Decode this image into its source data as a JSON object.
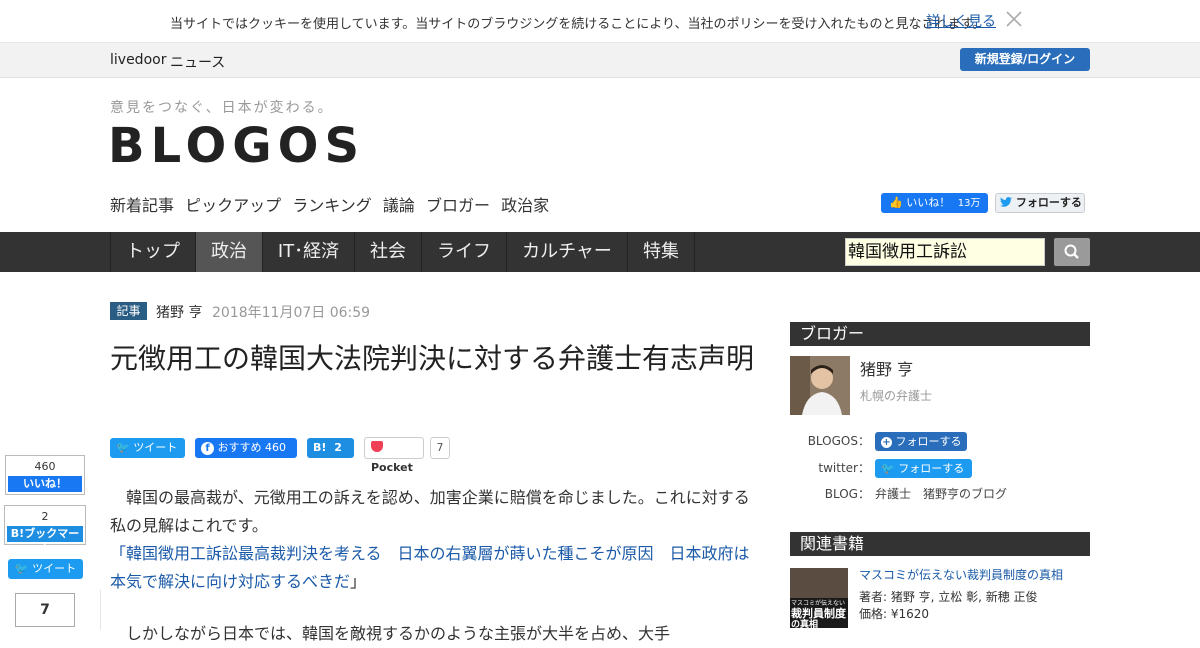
{
  "cookie": {
    "text": "当サイトではクッキーを使用しています。当サイトのブラウジングを続けることにより、当社のポリシーを受け入れたものと見なされます。",
    "link": "詳しく見る"
  },
  "livedoor": {
    "brand": "livedoor",
    "news": "ニュース",
    "login": "新規登録/ログイン"
  },
  "header": {
    "tagline": "意見をつなぐ、日本が変わる。",
    "logo": "BLOGOS",
    "subnav": [
      "新着記事",
      "ピックアップ",
      "ランキング",
      "議論",
      "ブロガー",
      "政治家"
    ],
    "fb_like": "いいね！",
    "fb_count": "13万",
    "tw_follow": "フォローする"
  },
  "mainnav": {
    "items": [
      "トップ",
      "政治",
      "IT･経済",
      "社会",
      "ライフ",
      "カルチャー",
      "特集"
    ],
    "active": "政治",
    "search_value": "韓国徴用工訴訟"
  },
  "side_share": {
    "fb_count": "460",
    "fb_label": "いいね！",
    "hb_count": "2",
    "hb_label": "B!ブックマーク",
    "tw_label": "ツイート",
    "pocket_count": "7"
  },
  "article": {
    "tag": "記事",
    "author": "猪野 亨",
    "date": "2018年11月07日 06:59",
    "title": "元徴用工の韓国大法院判決に対する弁護士有志声明",
    "share": {
      "tw": "ツイート",
      "fb": "おすすめ",
      "fb_count": "460",
      "hb": "B!",
      "hb_count": "2",
      "pocket": "Pocket",
      "pocket_count": "7"
    },
    "para1": "韓国の最高裁が、元徴用工の訴えを認め、加害企業に賠償を命じました。これに対する私の見解はこれです。",
    "link_open": "「",
    "link": "韓国徴用工訴訟最高裁判決を考える　日本の右翼層が蒔いた種こそが原因　日本政府は本気で解決に向け対応するべきだ",
    "link_close": "」",
    "para2": "しかしながら日本では、韓国を敵視するかのような主張が大半を占め、大手"
  },
  "sidebar": {
    "blogger_heading": "ブロガー",
    "blogger_name": "猪野 亨",
    "blogger_sub": "札幌の弁護士",
    "blogos_label": "BLOGOS：",
    "blogos_follow": "フォローする",
    "twitter_label": "twitter：",
    "twitter_follow": "フォローする",
    "blog_label": "BLOG：",
    "blog_link": "弁護士　猪野亨のブログ",
    "books_heading": "関連書籍",
    "book_title": "マスコミが伝えない裁判員制度の真相",
    "book_author": "著者: 猪野 亨, 立松 彰, 新穂 正俊",
    "book_price": "価格: ¥1620",
    "book_cover_top": "マスコミが伝えない",
    "book_cover_main": "裁判員制度",
    "book_cover_sub": "の真相"
  }
}
